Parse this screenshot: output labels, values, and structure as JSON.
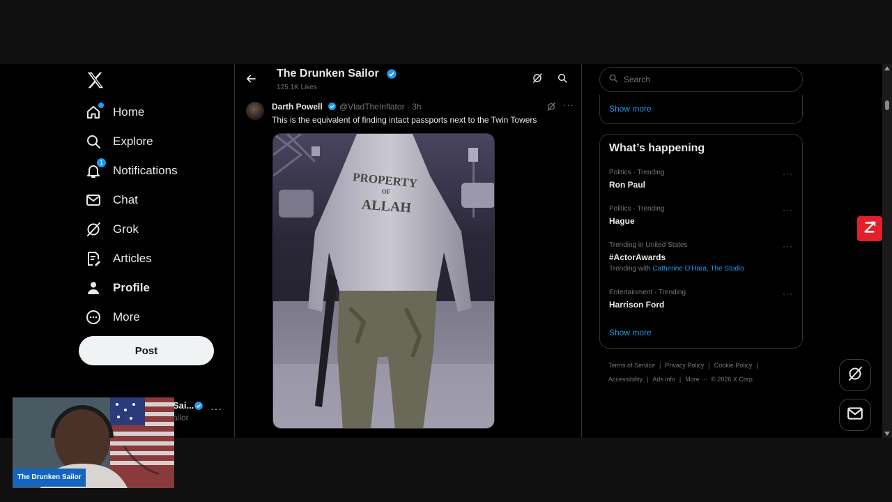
{
  "nav": {
    "items": [
      {
        "label": "Home",
        "icon": "home-icon"
      },
      {
        "label": "Explore",
        "icon": "search-icon"
      },
      {
        "label": "Notifications",
        "icon": "bell-icon",
        "badge": "1"
      },
      {
        "label": "Chat",
        "icon": "mail-icon"
      },
      {
        "label": "Grok",
        "icon": "grok-icon"
      },
      {
        "label": "Articles",
        "icon": "articles-icon"
      },
      {
        "label": "Profile",
        "icon": "person-icon"
      },
      {
        "label": "More",
        "icon": "more-circle-icon"
      }
    ],
    "post_label": "Post",
    "account": {
      "name": "Sai...",
      "handle": "ailor"
    }
  },
  "profile_header": {
    "title": "The Drunken Sailor",
    "subtitle": "125.1K Likes"
  },
  "tweet": {
    "author": "Darth Powell",
    "handle_time": "@VladTheInflator · 3h",
    "text": "This is the equivalent of finding intact passports next to the Twin Towers",
    "image_text": "PROPERTY OF ALLAH"
  },
  "right": {
    "search_placeholder": "Search",
    "show_more_1": "Show more",
    "happening_title": "What’s happening",
    "trends": [
      {
        "context": "Politics · Trending",
        "name": "Ron Paul"
      },
      {
        "context": "Politics · Trending",
        "name": "Hague"
      },
      {
        "context": "Trending in United States",
        "name": "#ActorAwards",
        "with_label": "Trending with",
        "with_1": "Catherine O'Hara",
        "with_sep": ",",
        "with_2": "The Studio"
      },
      {
        "context": "Entertainment · Trending",
        "name": "Harrison Ford"
      }
    ],
    "show_more_2": "Show more",
    "footer": {
      "terms": "Terms of Service",
      "privacy": "Privacy Policy",
      "cookie": "Cookie Policy",
      "accessibility": "Accessibility",
      "ads": "Ads info",
      "more": "More ···",
      "copyright": "© 2026 X Corp.",
      "sep": "|"
    }
  },
  "webcam": {
    "label": "The Drunken Sailor"
  },
  "colors": {
    "accent": "#1d9bf0",
    "background": "#000000",
    "extension": "#e0202a",
    "cam_label": "#1565c0"
  }
}
